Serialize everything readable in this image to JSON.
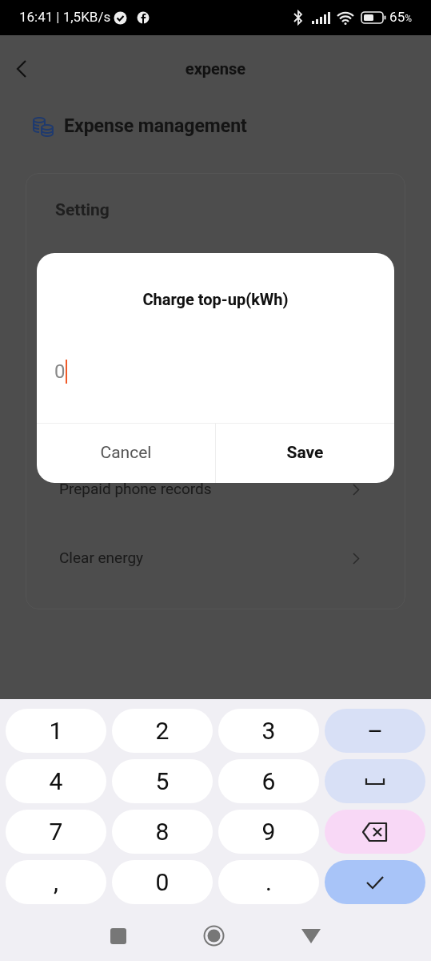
{
  "status_bar": {
    "time": "16:41",
    "speed": "| 1,5KB/s",
    "battery": "65",
    "battery_unit": "%"
  },
  "header": {
    "title": "expense"
  },
  "section": {
    "title": "Expense management"
  },
  "card": {
    "heading": "Setting",
    "rows": [
      {
        "label": "Prepaid phone records"
      },
      {
        "label": "Clear energy"
      }
    ]
  },
  "dialog": {
    "title": "Charge top-up(kWh)",
    "value": "0",
    "buttons": [
      {
        "label": "Cancel",
        "kind": "cancel"
      },
      {
        "label": "Save",
        "kind": "confirm"
      }
    ]
  },
  "keyboard": {
    "keys": [
      {
        "kind": "key",
        "label": "1"
      },
      {
        "kind": "key",
        "label": "2"
      },
      {
        "kind": "key",
        "label": "3"
      },
      {
        "kind": "minus",
        "label": "–"
      },
      {
        "kind": "key",
        "label": "4"
      },
      {
        "kind": "key",
        "label": "5"
      },
      {
        "kind": "key",
        "label": "6"
      },
      {
        "kind": "space"
      },
      {
        "kind": "key",
        "label": "7"
      },
      {
        "kind": "key",
        "label": "8"
      },
      {
        "kind": "key",
        "label": "9"
      },
      {
        "kind": "backspace"
      },
      {
        "kind": "key",
        "label": ","
      },
      {
        "kind": "key",
        "label": "0"
      },
      {
        "kind": "key",
        "label": "."
      },
      {
        "kind": "done"
      }
    ]
  }
}
